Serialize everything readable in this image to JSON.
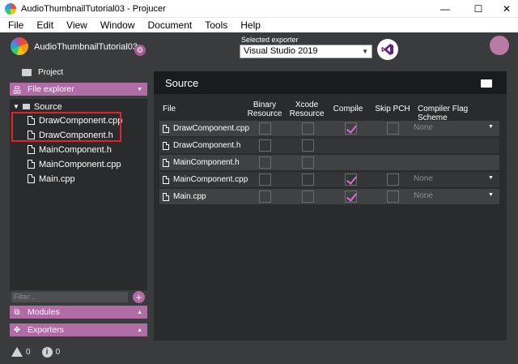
{
  "window": {
    "title": "AudioThumbnailTutorial03 - Projucer",
    "minimize": "—",
    "maximize": "☐",
    "close": "✕"
  },
  "menu": [
    "File",
    "Edit",
    "View",
    "Window",
    "Document",
    "Tools",
    "Help"
  ],
  "header": {
    "project_name": "AudioThumbnailTutorial03",
    "exporter_label": "Selected exporter",
    "exporter_value": "Visual Studio 2019"
  },
  "sidebar": {
    "project_tab": "Project",
    "file_explorer": "File explorer",
    "modules": "Modules",
    "exporters": "Exporters",
    "tree": {
      "group": "Source",
      "files": [
        "DrawComponent.cpp",
        "DrawComponent.h",
        "MainComponent.h",
        "MainComponent.cpp",
        "Main.cpp"
      ]
    },
    "filter_placeholder": "Filter..."
  },
  "status": {
    "warnings": "0",
    "infos": "0"
  },
  "main": {
    "title": "Source",
    "columns": {
      "file": "File",
      "binary": [
        "Binary",
        "Resource"
      ],
      "xcode": [
        "Xcode",
        "Resource"
      ],
      "compile": "Compile",
      "skip_pch": "Skip PCH",
      "scheme": "Compiler Flag Scheme"
    },
    "rows": [
      {
        "name": "DrawComponent.cpp",
        "binary": false,
        "xcode": false,
        "compile": true,
        "has_compile": true,
        "skip_pch": false,
        "scheme": "None"
      },
      {
        "name": "DrawComponent.h",
        "binary": false,
        "xcode": false,
        "compile": false,
        "has_compile": false,
        "skip_pch": false,
        "scheme": ""
      },
      {
        "name": "MainComponent.h",
        "binary": false,
        "xcode": false,
        "compile": false,
        "has_compile": false,
        "skip_pch": false,
        "scheme": ""
      },
      {
        "name": "MainComponent.cpp",
        "binary": false,
        "xcode": false,
        "compile": true,
        "has_compile": true,
        "skip_pch": false,
        "scheme": "None"
      },
      {
        "name": "Main.cpp",
        "binary": false,
        "xcode": false,
        "compile": true,
        "has_compile": true,
        "skip_pch": false,
        "scheme": "None"
      }
    ]
  },
  "colors": {
    "accent": "#b06ca5",
    "check": "#d66fd0",
    "highlight": "#e0242b",
    "background": "#3a3b3d",
    "panel": "#2a2b2d"
  },
  "icons": {
    "app": "projucer-icon",
    "gear": "gear-icon",
    "vs": "visual-studio-icon",
    "user": "user-icon",
    "folder": "folder-icon",
    "file": "file-icon",
    "warning": "warning-icon",
    "info": "info-icon"
  }
}
